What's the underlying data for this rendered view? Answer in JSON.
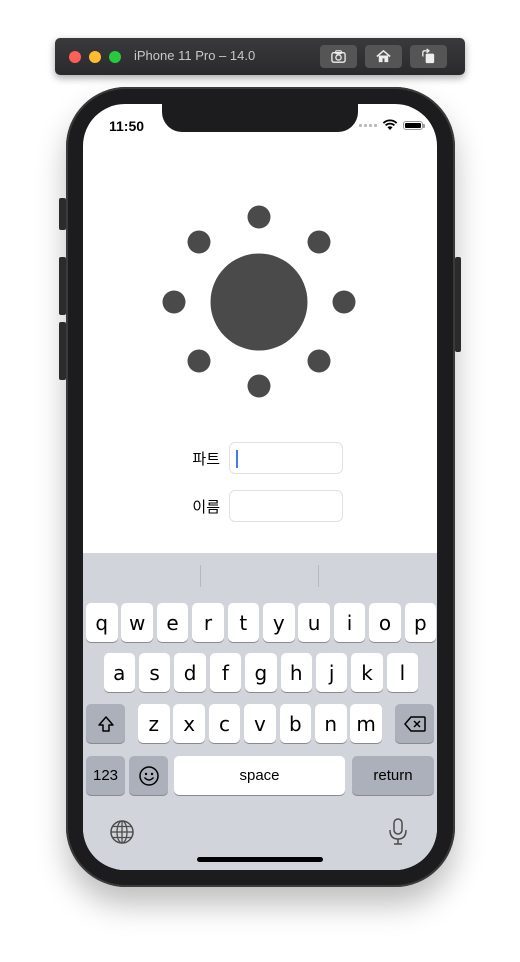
{
  "simulator": {
    "title": "iPhone 11 Pro – 14.0",
    "buttons": [
      "screenshot-icon",
      "home-icon",
      "rotate-icon"
    ]
  },
  "status_bar": {
    "time": "11:50",
    "icons": [
      "signal-icon",
      "wifi-icon",
      "battery-icon"
    ]
  },
  "app": {
    "logo": "sun-icon",
    "accent": "#4a4a4a",
    "form": {
      "part_label": "파트",
      "part_value": "",
      "name_label": "이름",
      "name_value": ""
    }
  },
  "keyboard": {
    "row1": [
      "q",
      "w",
      "e",
      "r",
      "t",
      "y",
      "u",
      "i",
      "o",
      "p"
    ],
    "row2": [
      "a",
      "s",
      "d",
      "f",
      "g",
      "h",
      "j",
      "k",
      "l"
    ],
    "row3": [
      "z",
      "x",
      "c",
      "v",
      "b",
      "n",
      "m"
    ],
    "numbers_label": "123",
    "space_label": "space",
    "return_label": "return",
    "icons": [
      "shift-icon",
      "backspace-icon",
      "emoji-icon",
      "globe-icon",
      "microphone-icon"
    ]
  }
}
